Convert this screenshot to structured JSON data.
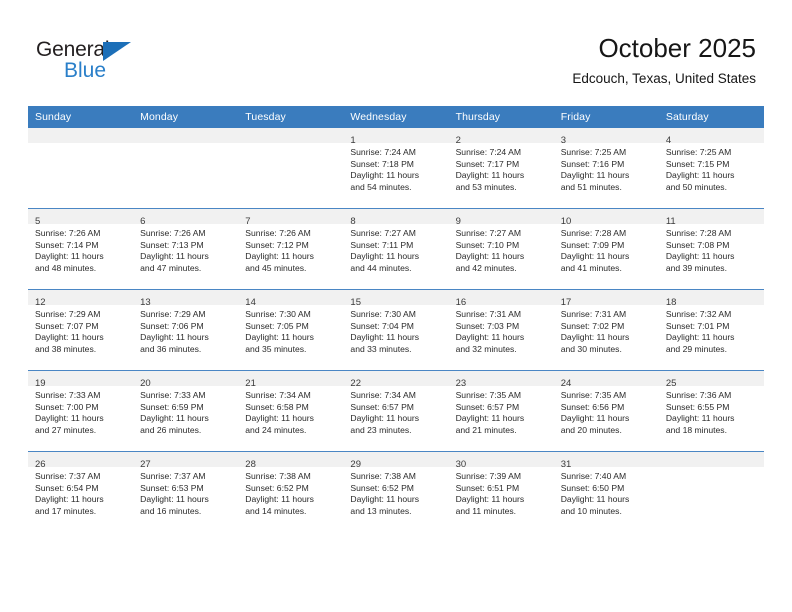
{
  "brand": {
    "name_top": "General",
    "name_bottom": "Blue",
    "triangle_color": "#1c6fb8",
    "blue_color": "#2a7fc9"
  },
  "header": {
    "title": "October 2025",
    "location": "Edcouch, Texas, United States"
  },
  "theme": {
    "header_band": "#3a7cbe",
    "daynum_strip": "#f1f1f1",
    "grid_line": "#4a86c4"
  },
  "weekdays": [
    "Sunday",
    "Monday",
    "Tuesday",
    "Wednesday",
    "Thursday",
    "Friday",
    "Saturday"
  ],
  "weeks": [
    [
      {
        "empty": true
      },
      {
        "empty": true
      },
      {
        "empty": true
      },
      {
        "day": "1",
        "sunrise": "Sunrise: 7:24 AM",
        "sunset": "Sunset: 7:18 PM",
        "daylight1": "Daylight: 11 hours",
        "daylight2": "and 54 minutes."
      },
      {
        "day": "2",
        "sunrise": "Sunrise: 7:24 AM",
        "sunset": "Sunset: 7:17 PM",
        "daylight1": "Daylight: 11 hours",
        "daylight2": "and 53 minutes."
      },
      {
        "day": "3",
        "sunrise": "Sunrise: 7:25 AM",
        "sunset": "Sunset: 7:16 PM",
        "daylight1": "Daylight: 11 hours",
        "daylight2": "and 51 minutes."
      },
      {
        "day": "4",
        "sunrise": "Sunrise: 7:25 AM",
        "sunset": "Sunset: 7:15 PM",
        "daylight1": "Daylight: 11 hours",
        "daylight2": "and 50 minutes."
      }
    ],
    [
      {
        "day": "5",
        "sunrise": "Sunrise: 7:26 AM",
        "sunset": "Sunset: 7:14 PM",
        "daylight1": "Daylight: 11 hours",
        "daylight2": "and 48 minutes."
      },
      {
        "day": "6",
        "sunrise": "Sunrise: 7:26 AM",
        "sunset": "Sunset: 7:13 PM",
        "daylight1": "Daylight: 11 hours",
        "daylight2": "and 47 minutes."
      },
      {
        "day": "7",
        "sunrise": "Sunrise: 7:26 AM",
        "sunset": "Sunset: 7:12 PM",
        "daylight1": "Daylight: 11 hours",
        "daylight2": "and 45 minutes."
      },
      {
        "day": "8",
        "sunrise": "Sunrise: 7:27 AM",
        "sunset": "Sunset: 7:11 PM",
        "daylight1": "Daylight: 11 hours",
        "daylight2": "and 44 minutes."
      },
      {
        "day": "9",
        "sunrise": "Sunrise: 7:27 AM",
        "sunset": "Sunset: 7:10 PM",
        "daylight1": "Daylight: 11 hours",
        "daylight2": "and 42 minutes."
      },
      {
        "day": "10",
        "sunrise": "Sunrise: 7:28 AM",
        "sunset": "Sunset: 7:09 PM",
        "daylight1": "Daylight: 11 hours",
        "daylight2": "and 41 minutes."
      },
      {
        "day": "11",
        "sunrise": "Sunrise: 7:28 AM",
        "sunset": "Sunset: 7:08 PM",
        "daylight1": "Daylight: 11 hours",
        "daylight2": "and 39 minutes."
      }
    ],
    [
      {
        "day": "12",
        "sunrise": "Sunrise: 7:29 AM",
        "sunset": "Sunset: 7:07 PM",
        "daylight1": "Daylight: 11 hours",
        "daylight2": "and 38 minutes."
      },
      {
        "day": "13",
        "sunrise": "Sunrise: 7:29 AM",
        "sunset": "Sunset: 7:06 PM",
        "daylight1": "Daylight: 11 hours",
        "daylight2": "and 36 minutes."
      },
      {
        "day": "14",
        "sunrise": "Sunrise: 7:30 AM",
        "sunset": "Sunset: 7:05 PM",
        "daylight1": "Daylight: 11 hours",
        "daylight2": "and 35 minutes."
      },
      {
        "day": "15",
        "sunrise": "Sunrise: 7:30 AM",
        "sunset": "Sunset: 7:04 PM",
        "daylight1": "Daylight: 11 hours",
        "daylight2": "and 33 minutes."
      },
      {
        "day": "16",
        "sunrise": "Sunrise: 7:31 AM",
        "sunset": "Sunset: 7:03 PM",
        "daylight1": "Daylight: 11 hours",
        "daylight2": "and 32 minutes."
      },
      {
        "day": "17",
        "sunrise": "Sunrise: 7:31 AM",
        "sunset": "Sunset: 7:02 PM",
        "daylight1": "Daylight: 11 hours",
        "daylight2": "and 30 minutes."
      },
      {
        "day": "18",
        "sunrise": "Sunrise: 7:32 AM",
        "sunset": "Sunset: 7:01 PM",
        "daylight1": "Daylight: 11 hours",
        "daylight2": "and 29 minutes."
      }
    ],
    [
      {
        "day": "19",
        "sunrise": "Sunrise: 7:33 AM",
        "sunset": "Sunset: 7:00 PM",
        "daylight1": "Daylight: 11 hours",
        "daylight2": "and 27 minutes."
      },
      {
        "day": "20",
        "sunrise": "Sunrise: 7:33 AM",
        "sunset": "Sunset: 6:59 PM",
        "daylight1": "Daylight: 11 hours",
        "daylight2": "and 26 minutes."
      },
      {
        "day": "21",
        "sunrise": "Sunrise: 7:34 AM",
        "sunset": "Sunset: 6:58 PM",
        "daylight1": "Daylight: 11 hours",
        "daylight2": "and 24 minutes."
      },
      {
        "day": "22",
        "sunrise": "Sunrise: 7:34 AM",
        "sunset": "Sunset: 6:57 PM",
        "daylight1": "Daylight: 11 hours",
        "daylight2": "and 23 minutes."
      },
      {
        "day": "23",
        "sunrise": "Sunrise: 7:35 AM",
        "sunset": "Sunset: 6:57 PM",
        "daylight1": "Daylight: 11 hours",
        "daylight2": "and 21 minutes."
      },
      {
        "day": "24",
        "sunrise": "Sunrise: 7:35 AM",
        "sunset": "Sunset: 6:56 PM",
        "daylight1": "Daylight: 11 hours",
        "daylight2": "and 20 minutes."
      },
      {
        "day": "25",
        "sunrise": "Sunrise: 7:36 AM",
        "sunset": "Sunset: 6:55 PM",
        "daylight1": "Daylight: 11 hours",
        "daylight2": "and 18 minutes."
      }
    ],
    [
      {
        "day": "26",
        "sunrise": "Sunrise: 7:37 AM",
        "sunset": "Sunset: 6:54 PM",
        "daylight1": "Daylight: 11 hours",
        "daylight2": "and 17 minutes."
      },
      {
        "day": "27",
        "sunrise": "Sunrise: 7:37 AM",
        "sunset": "Sunset: 6:53 PM",
        "daylight1": "Daylight: 11 hours",
        "daylight2": "and 16 minutes."
      },
      {
        "day": "28",
        "sunrise": "Sunrise: 7:38 AM",
        "sunset": "Sunset: 6:52 PM",
        "daylight1": "Daylight: 11 hours",
        "daylight2": "and 14 minutes."
      },
      {
        "day": "29",
        "sunrise": "Sunrise: 7:38 AM",
        "sunset": "Sunset: 6:52 PM",
        "daylight1": "Daylight: 11 hours",
        "daylight2": "and 13 minutes."
      },
      {
        "day": "30",
        "sunrise": "Sunrise: 7:39 AM",
        "sunset": "Sunset: 6:51 PM",
        "daylight1": "Daylight: 11 hours",
        "daylight2": "and 11 minutes."
      },
      {
        "day": "31",
        "sunrise": "Sunrise: 7:40 AM",
        "sunset": "Sunset: 6:50 PM",
        "daylight1": "Daylight: 11 hours",
        "daylight2": "and 10 minutes."
      },
      {
        "empty": true
      }
    ]
  ]
}
